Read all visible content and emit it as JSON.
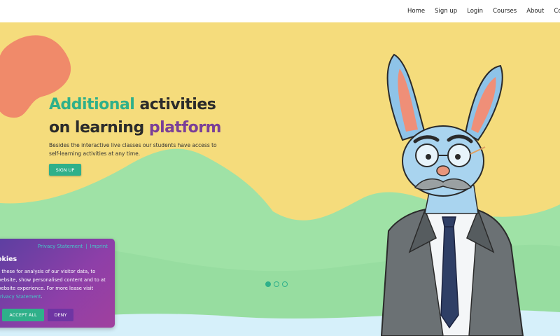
{
  "nav": {
    "items": [
      "Home",
      "Sign up",
      "Login",
      "Courses",
      "About",
      "Contact"
    ]
  },
  "hero": {
    "headline_line1_accent": "Additional",
    "headline_line1_rest": " activities",
    "headline_line2_start": "on learning ",
    "headline_line2_accent": "platform",
    "subtext": "Besides the interactive live classes our students have access to self-learning activities at any time.",
    "cta_label": "SIGN UP"
  },
  "carousel": {
    "slide_count": 3,
    "active_index": 0
  },
  "cookie_banner": {
    "privacy_link": "Privacy Statement",
    "separator": "|",
    "imprint_link": "Imprint",
    "title": "okies",
    "text": "e these for analysis of our visitor data, to website, show personalised content and to at website experience. For more lease visit ",
    "text_link": "Privacy Statement",
    "text_end": ".",
    "accept_label": "ACCEPT ALL",
    "deny_label": "DENY"
  },
  "colors": {
    "accent_green": "#2fb08a",
    "accent_purple": "#7a3f98",
    "background_yellow": "#f5dc7c",
    "hill_green": "#9fe2a6",
    "blob_salmon": "#f08a6a"
  },
  "icons": [
    "rabbit-teacher-illustration"
  ]
}
